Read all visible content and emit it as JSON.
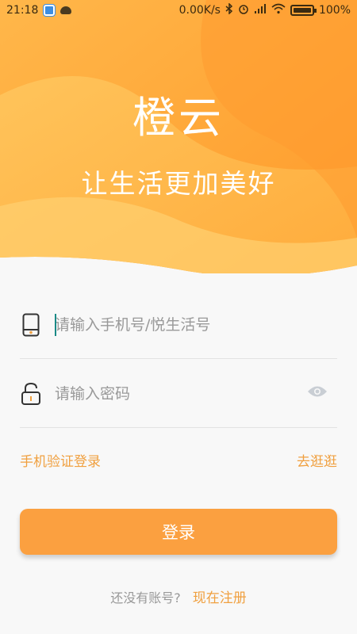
{
  "status_bar": {
    "time": "21:18",
    "network_speed": "0.00K/s",
    "battery_percent": "100%"
  },
  "hero": {
    "title": "橙云",
    "slogan": "让生活更加美好"
  },
  "form": {
    "phone_placeholder": "请输入手机号/悦生活号",
    "password_placeholder": "请输入密码"
  },
  "links": {
    "sms_login": "手机验证登录",
    "browse": "去逛逛"
  },
  "login_button": "登录",
  "register": {
    "question": "还没有账号?",
    "action": "现在注册"
  },
  "colors": {
    "accent": "#fba040",
    "link": "#f0a040"
  }
}
